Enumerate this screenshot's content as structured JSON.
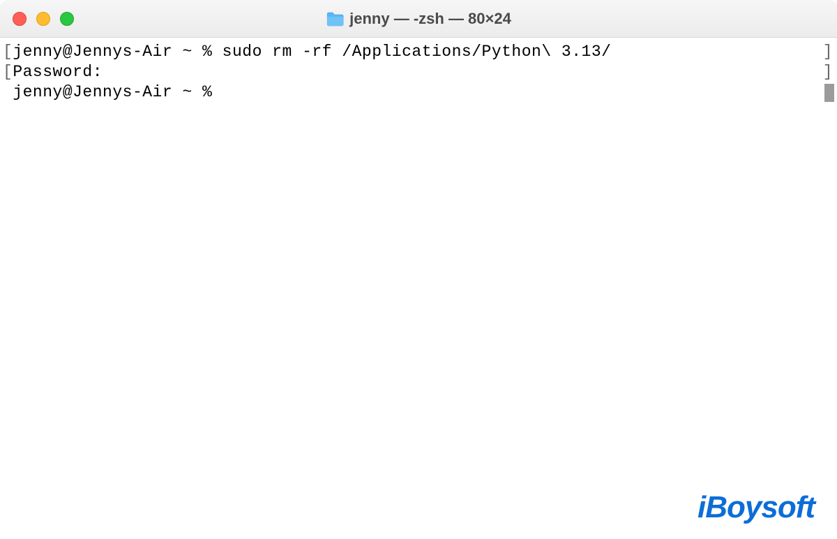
{
  "window": {
    "title": "jenny — -zsh — 80×24"
  },
  "terminal": {
    "lines": [
      {
        "open_bracket": "[",
        "text": "jenny@Jennys-Air ~ % sudo rm -rf /Applications/Python\\ 3.13/",
        "close_bracket": "]"
      },
      {
        "open_bracket": "[",
        "text": "Password:",
        "close_bracket": "]"
      },
      {
        "open_bracket": " ",
        "text": "jenny@Jennys-Air ~ % ",
        "close_bracket": ""
      }
    ]
  },
  "watermark": {
    "text": "iBoysoft"
  },
  "colors": {
    "close": "#ff5f57",
    "minimize": "#febc2e",
    "maximize": "#28c840",
    "brand": "#0d6dd7"
  }
}
